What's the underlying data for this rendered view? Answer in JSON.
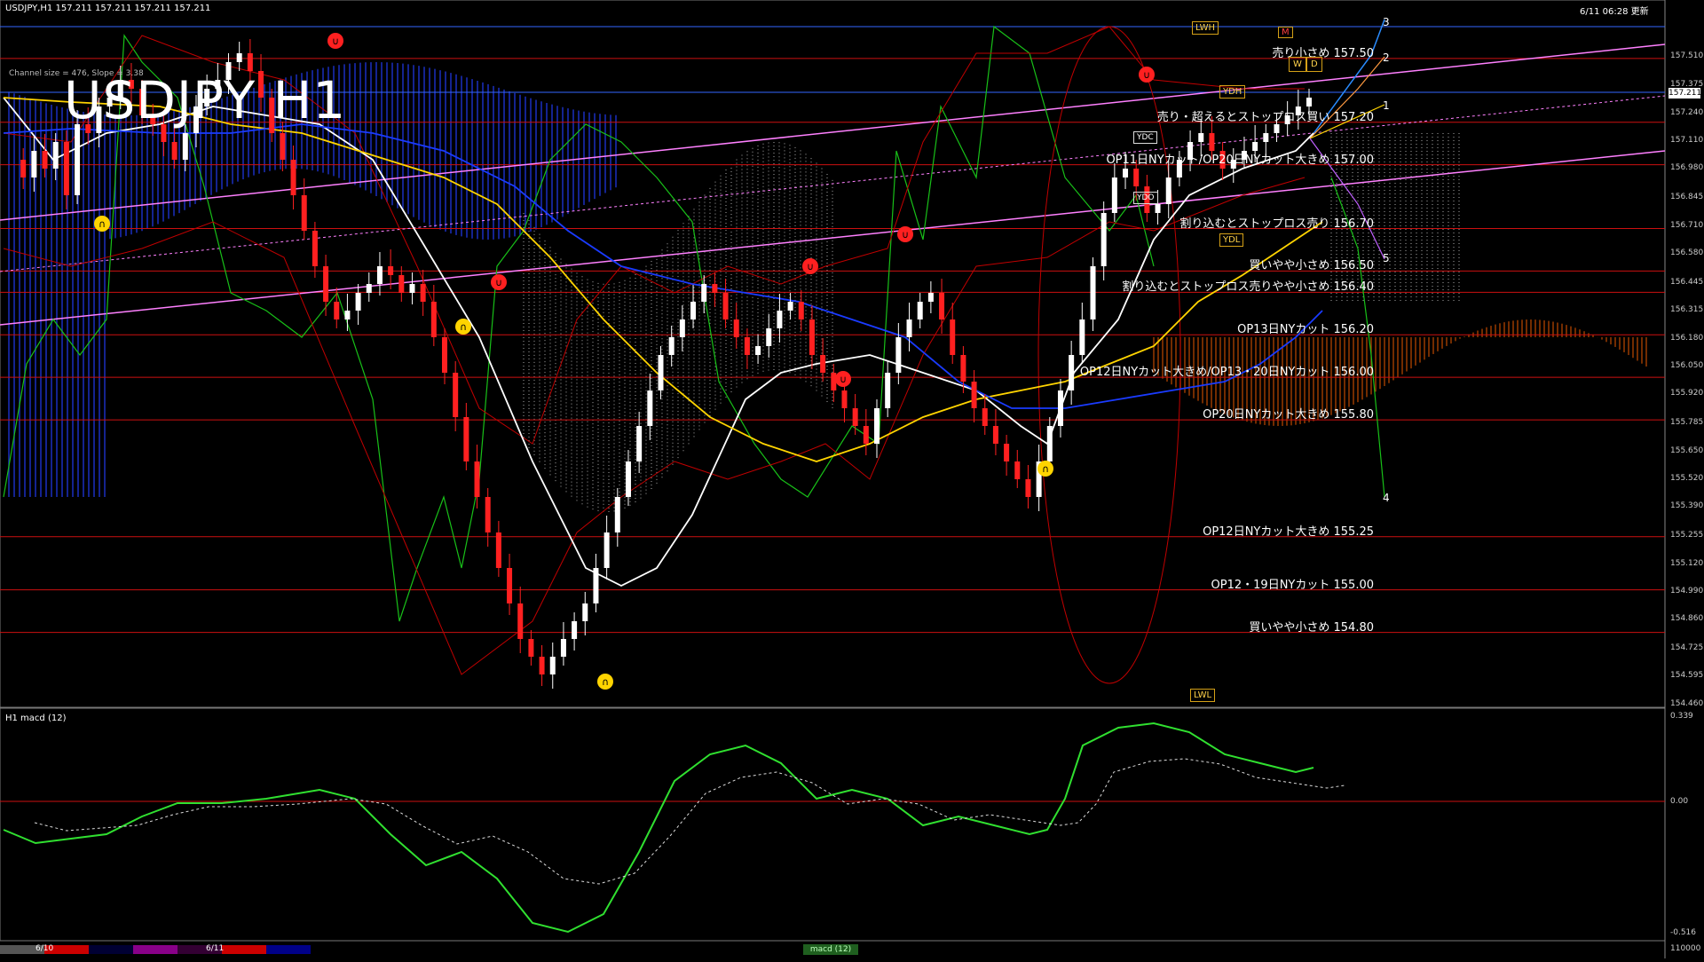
{
  "header": {
    "symbol_line": "USDJPY,H1  157.211 157.211 157.211 157.211",
    "timestamp": "6/11 06:28 更新"
  },
  "chart_title": "USDJPY H1",
  "channel_info": "Channel size = 476, Slope = 3.38",
  "current_price": "157.211",
  "chart_data": {
    "type": "candlestick",
    "title": "USDJPY H1",
    "ylim": [
      154.46,
      157.65
    ],
    "y_ticks": [
      "157.510",
      "157.375",
      "157.240",
      "157.110",
      "156.980",
      "156.845",
      "156.710",
      "156.580",
      "156.445",
      "156.315",
      "156.180",
      "156.050",
      "155.920",
      "155.785",
      "155.650",
      "155.520",
      "155.390",
      "155.255",
      "155.120",
      "154.990",
      "154.860",
      "154.725",
      "154.595",
      "154.460"
    ],
    "price_levels": [
      {
        "price": 157.5,
        "label": "売り小さめ 157.50"
      },
      {
        "price": 157.2,
        "label": "売り・超えるとストップロス買い 157.20"
      },
      {
        "price": 157.0,
        "label": "OP11日NYカット/OP20日NYカット大きめ 157.00"
      },
      {
        "price": 156.7,
        "label": "割り込むとストップロス売り 156.70"
      },
      {
        "price": 156.5,
        "label": "買いやや小さめ 156.50"
      },
      {
        "price": 156.4,
        "label": "割り込むとストップロス売りやや小さめ 156.40"
      },
      {
        "price": 156.2,
        "label": "OP13日NYカット 156.20"
      },
      {
        "price": 156.0,
        "label": "OP12日NYカット大きめ/OP13・20日NYカット 156.00"
      },
      {
        "price": 155.8,
        "label": "OP20日NYカット大きめ 155.80"
      },
      {
        "price": 155.25,
        "label": "OP12日NYカット大きめ 155.25"
      },
      {
        "price": 155.0,
        "label": "OP12・19日NYカット 155.00"
      },
      {
        "price": 154.8,
        "label": "買いやや小さめ 154.80"
      }
    ],
    "projection_labels": [
      "1",
      "2",
      "3",
      "4",
      "5"
    ],
    "boxes": [
      "LWH",
      "YDH",
      "YDL",
      "LWL",
      "YDC",
      "YDO",
      "W",
      "D",
      "M"
    ]
  },
  "macd": {
    "title": "H1  macd (12)",
    "y_ticks": [
      "0.339",
      "0.00",
      "-0.516"
    ]
  },
  "footer": {
    "date_left": "6/10",
    "date_right": "6/11",
    "macd_tab": "macd (12)",
    "volume": "110000"
  },
  "colors": {
    "background": "#000000",
    "bull_candle": "#ffffff",
    "bear_candle": "#ff2020",
    "sma_white": "#ffffff",
    "sma_yellow": "#ffd400",
    "sma_blue": "#1a3bff",
    "bollinger": "#c00000",
    "chikou": "#18c018",
    "channel": "#ff80ff",
    "level_line": "#cc1010",
    "macd_up": "#30e030",
    "macd_down": "#ff80b0"
  }
}
